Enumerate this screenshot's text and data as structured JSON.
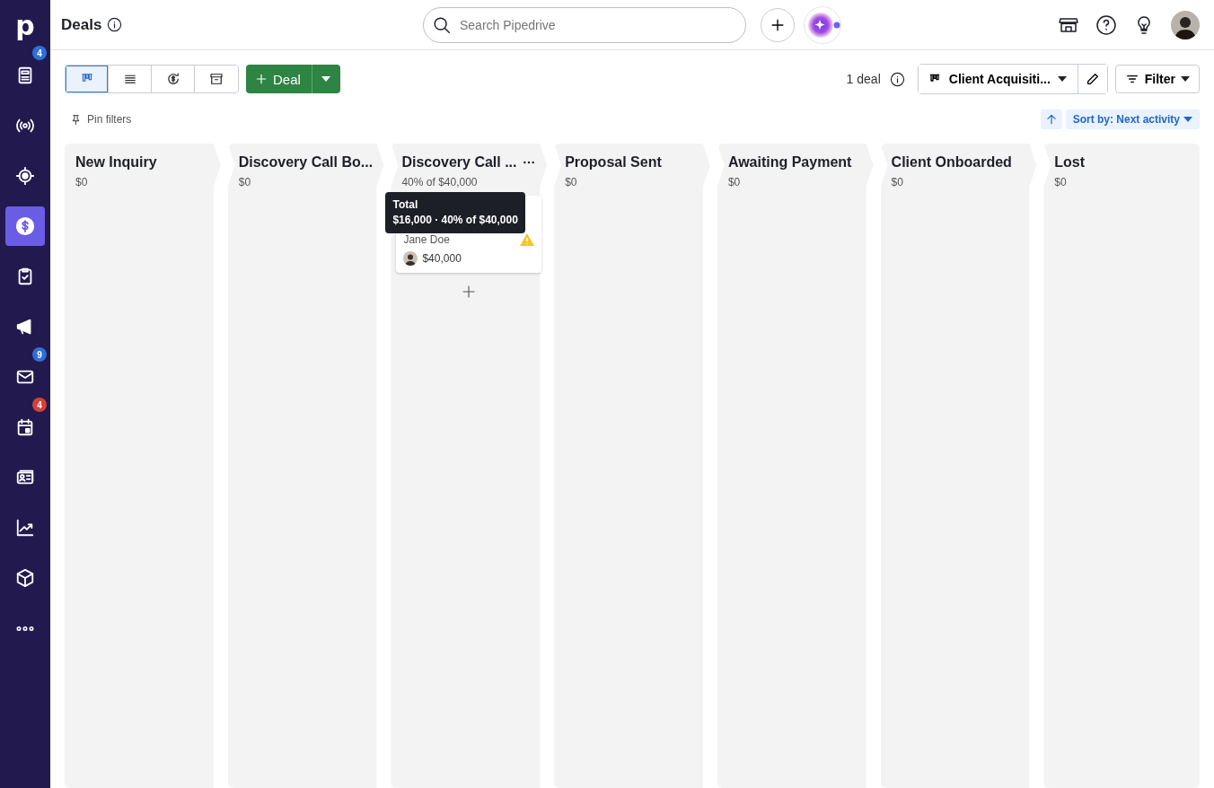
{
  "sidebar": {
    "logo": "p",
    "items": [
      {
        "selected": false,
        "badge": "4",
        "color": "#2f6fd6"
      },
      {
        "selected": false
      },
      {
        "selected": false
      },
      {
        "selected": true
      },
      {
        "selected": false
      },
      {
        "selected": false
      },
      {
        "selected": false,
        "badge": "9",
        "color": "#2f6fd6"
      },
      {
        "selected": false,
        "badge": "4",
        "color": "#d4403a"
      },
      {
        "selected": false
      },
      {
        "selected": false
      },
      {
        "selected": false
      },
      {
        "selected": false
      }
    ]
  },
  "header": {
    "title": "Deals",
    "search": {
      "placeholder": "Search Pipedrive"
    }
  },
  "toolbar": {
    "views": [
      {
        "selected": true
      },
      {
        "selected": false
      },
      {
        "selected": false
      },
      {
        "selected": false
      }
    ],
    "add_button": "Deal",
    "deal_count": "1 deal",
    "pipeline": "Client Acquisiti...",
    "filter": "Filter",
    "pin_filters": "Pin filters",
    "sort": "Sort by: Next activity"
  },
  "stages": [
    {
      "title": "New Inquiry",
      "amount": "$0"
    },
    {
      "title": "Discovery Call Bo...",
      "amount": "$0"
    },
    {
      "title": "Discovery Call ...",
      "amount": "40% of $40,000",
      "menu": true,
      "add": true,
      "deals": [
        {
          "person": "Jane Doe",
          "value": "$40,000",
          "warning": true
        }
      ],
      "tooltip": {
        "title": "Total",
        "text": "$16,000 · 40% of $40,000"
      }
    },
    {
      "title": "Proposal Sent",
      "amount": "$0"
    },
    {
      "title": "Awaiting Payment",
      "amount": "$0"
    },
    {
      "title": "Client Onboarded",
      "amount": "$0"
    },
    {
      "title": "Lost",
      "amount": "$0"
    }
  ]
}
